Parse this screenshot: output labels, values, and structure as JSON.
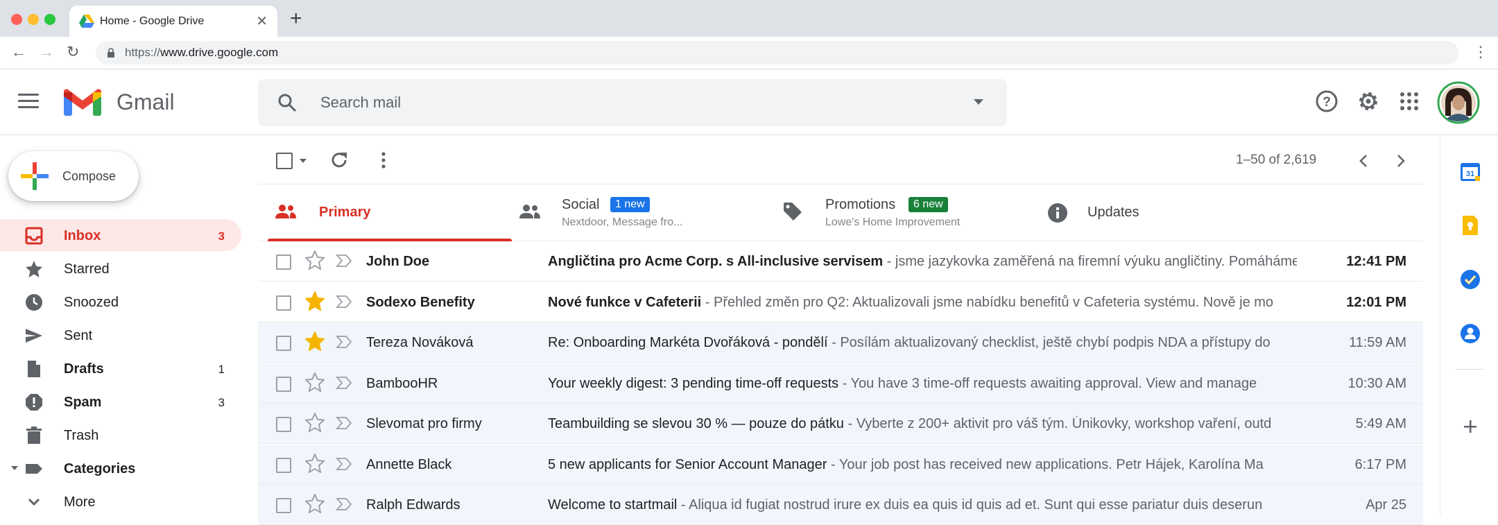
{
  "browser": {
    "tab_title": "Home - Google Drive",
    "url_protocol": "https://",
    "url_host": "www.drive.google.com"
  },
  "header": {
    "app_name": "Gmail",
    "search_placeholder": "Search mail",
    "avatar_border_color": "#34a853"
  },
  "compose": {
    "label": "Compose"
  },
  "sidebar": {
    "items": [
      {
        "label": "Inbox",
        "count": "3",
        "icon": "inbox-icon",
        "active": true,
        "bold": true
      },
      {
        "label": "Starred",
        "count": "",
        "icon": "star-icon",
        "active": false,
        "bold": false
      },
      {
        "label": "Snoozed",
        "count": "",
        "icon": "clock-icon",
        "active": false,
        "bold": false
      },
      {
        "label": "Sent",
        "count": "",
        "icon": "send-icon",
        "active": false,
        "bold": false
      },
      {
        "label": "Drafts",
        "count": "1",
        "icon": "draft-icon",
        "active": false,
        "bold": true
      },
      {
        "label": "Spam",
        "count": "3",
        "icon": "spam-icon",
        "active": false,
        "bold": true
      },
      {
        "label": "Trash",
        "count": "",
        "icon": "trash-icon",
        "active": false,
        "bold": false
      },
      {
        "label": "Categories",
        "count": "",
        "icon": "label-icon",
        "active": false,
        "bold": true
      },
      {
        "label": "More",
        "count": "",
        "icon": "chevron-down-icon",
        "active": false,
        "bold": false
      }
    ]
  },
  "toolbar": {
    "pager": "1–50 of 2,619"
  },
  "tabs": [
    {
      "label": "Primary",
      "sub": "",
      "badge": "",
      "active": true,
      "icon": "inbox-tab-icon"
    },
    {
      "label": "Social",
      "sub": "Nextdoor, Message fro...",
      "badge": "1 new",
      "badge_color": "#1a73e8",
      "active": false,
      "icon": "people-icon"
    },
    {
      "label": "Promotions",
      "sub": "Lowe's Home Improvement",
      "badge": "6 new",
      "badge_color": "#188038",
      "active": false,
      "icon": "tag-icon"
    },
    {
      "label": "Updates",
      "sub": "",
      "badge": "",
      "active": false,
      "icon": "info-icon"
    }
  ],
  "emails": [
    {
      "sender": "John Doe",
      "subject": "Angličtina pro Acme Corp. s All-inclusive servisem",
      "snippet": " - jsme jazykovka zaměřená na firemní výuku angličtiny. Pomáháme",
      "time": "12:41 PM",
      "unread": true,
      "starred": false
    },
    {
      "sender": "Sodexo Benefity",
      "subject": "Nové funkce v Cafeterii",
      "snippet": " - Přehled změn pro Q2: Aktualizovali jsme nabídku benefitů v Cafeteria systému. Nově je mo",
      "time": "12:01 PM",
      "unread": true,
      "starred": true
    },
    {
      "sender": "Tereza Nováková",
      "subject": "Re: Onboarding Markéta Dvořáková - pondělí",
      "snippet": " - Posílám aktualizovaný checklist, ještě chybí podpis NDA a přístupy do",
      "time": "11:59 AM",
      "unread": false,
      "starred": true
    },
    {
      "sender": "BambooHR",
      "subject": "Your weekly digest: 3 pending time-off requests",
      "snippet": " - You have 3 time-off requests awaiting approval. View and manage",
      "time": "10:30 AM",
      "unread": false,
      "starred": false
    },
    {
      "sender": "Slevomat pro firmy",
      "subject": "Teambuilding se slevou 30 % — pouze do pátku",
      "snippet": " - Vyberte z 200+ aktivit pro váš tým. Únikovky, workshop vaření, outd",
      "time": "5:49 AM",
      "unread": false,
      "starred": false
    },
    {
      "sender": "Annette Black",
      "subject": "5 new applicants for Senior Account Manager",
      "snippet": " - Your job post has received new applications. Petr Hájek, Karolína Ma",
      "time": "6:17 PM",
      "unread": false,
      "starred": false
    },
    {
      "sender": "Ralph Edwards",
      "subject": "Welcome to startmail",
      "snippet": " - Aliqua id fugiat nostrud irure ex duis ea quis id quis ad et. Sunt qui esse pariatur duis deserun",
      "time": "Apr 25",
      "unread": false,
      "starred": false
    }
  ],
  "colors": {
    "accent_red": "#d93025",
    "star_yellow": "#f4b400"
  }
}
